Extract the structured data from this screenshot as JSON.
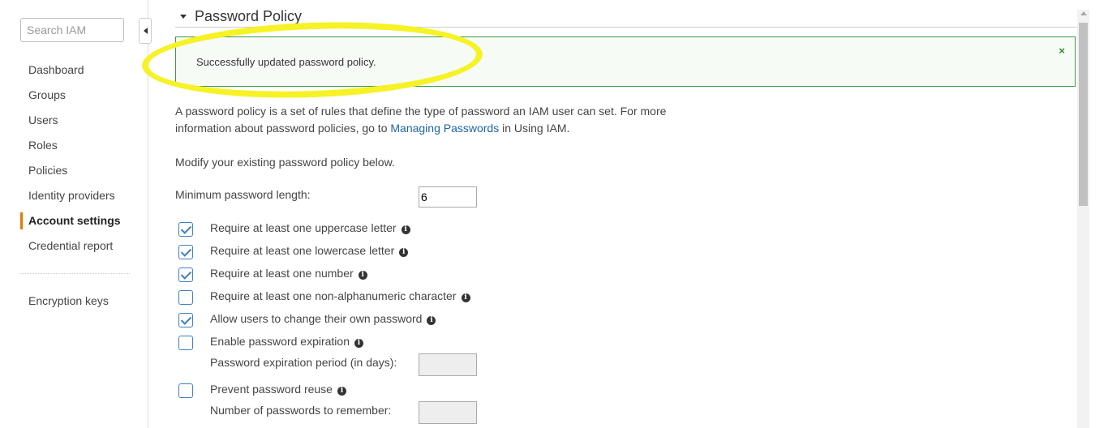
{
  "sidebar": {
    "search_placeholder": "Search IAM",
    "items": [
      {
        "label": "Dashboard"
      },
      {
        "label": "Groups"
      },
      {
        "label": "Users"
      },
      {
        "label": "Roles"
      },
      {
        "label": "Policies"
      },
      {
        "label": "Identity providers"
      },
      {
        "label": "Account settings",
        "active": true
      },
      {
        "label": "Credential report"
      }
    ],
    "secondary_item": "Encryption keys"
  },
  "main": {
    "title": "Password Policy",
    "alert": {
      "message": "Successfully updated password policy.",
      "close_symbol": "×"
    },
    "description": {
      "text_before": "A password policy is a set of rules that define the type of password an IAM user can set. For more information about password policies, go to ",
      "link": "Managing Passwords",
      "text_after": " in Using IAM."
    },
    "modify_text": "Modify your existing password policy below.",
    "min_length": {
      "label": "Minimum password length:",
      "value": "6"
    },
    "options": [
      {
        "label": "Require at least one uppercase letter",
        "checked": true
      },
      {
        "label": "Require at least one lowercase letter",
        "checked": true
      },
      {
        "label": "Require at least one number",
        "checked": true
      },
      {
        "label": "Require at least one non-alphanumeric character",
        "checked": false
      },
      {
        "label": "Allow users to change their own password",
        "checked": true
      },
      {
        "label": "Enable password expiration",
        "checked": false
      },
      {
        "label": "Prevent password reuse",
        "checked": false
      }
    ],
    "expiration_period_label": "Password expiration period (in days):",
    "remember_label": "Number of passwords to remember:"
  },
  "colors": {
    "accent_active": "#e07b00",
    "alert_border": "#3c9a43",
    "link": "#1a66aa",
    "checkbox": "#3d7fc2",
    "highlight": "#f6f226"
  },
  "icons": [
    "collapse-arrow-icon",
    "expand-caret-icon",
    "close-icon",
    "info-icon"
  ]
}
